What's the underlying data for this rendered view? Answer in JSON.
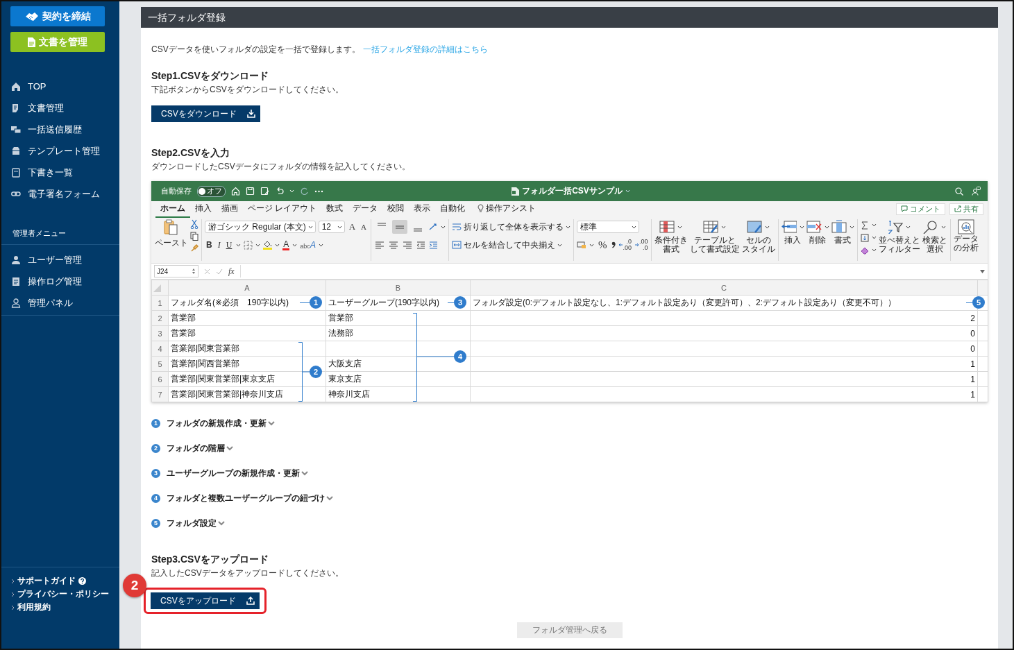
{
  "sidebar": {
    "action_buttons": [
      {
        "label": "契約を締結",
        "kind": "sign"
      },
      {
        "label": "文書を管理",
        "kind": "manage"
      }
    ],
    "nav_items": [
      {
        "label": "TOP",
        "kind": "home"
      },
      {
        "label": "文書管理",
        "kind": "document"
      },
      {
        "label": "一括送信履歴",
        "kind": "batch"
      },
      {
        "label": "テンプレート管理",
        "kind": "template"
      },
      {
        "label": "下書き一覧",
        "kind": "draft"
      },
      {
        "label": "電子署名フォーム",
        "kind": "link"
      }
    ],
    "admin_heading": "管理者メニュー",
    "admin_items": [
      {
        "label": "ユーザー管理",
        "kind": "user"
      },
      {
        "label": "操作ログ管理",
        "kind": "log"
      },
      {
        "label": "管理パネル",
        "kind": "panel"
      }
    ],
    "footer_links": [
      {
        "label": "サポートガイド",
        "help": true
      },
      {
        "label": "プライバシー・ポリシー",
        "help": false
      },
      {
        "label": "利用規約",
        "help": false
      }
    ]
  },
  "panel": {
    "title": "一括フォルダ登録",
    "intro": "CSVデータを使いフォルダの設定を一括で登録します。",
    "intro_link": "一括フォルダ登録の詳細はこちら",
    "steps": [
      {
        "heading": "Step1.CSVをダウンロード",
        "description": "下記ボタンからCSVをダウンロードしてください。",
        "button": {
          "label": "CSVをダウンロード",
          "kind": "download"
        }
      },
      {
        "heading": "Step2.CSVを入力",
        "description": "ダウンロードしたCSVデータにフォルダの情報を記入してください。",
        "spreadsheet": {
          "autosave_label": "自動保存",
          "autosave": {
            "label": "オフ",
            "on": false
          },
          "file_title": "フォルダ一括CSVサンプル",
          "ribbon_tabs": [
            {
              "label": "ホーム",
              "selected": true
            },
            {
              "label": "挿入",
              "selected": false
            },
            {
              "label": "描画",
              "selected": false
            },
            {
              "label": "ページ レイアウト",
              "selected": false
            },
            {
              "label": "数式",
              "selected": false
            },
            {
              "label": "データ",
              "selected": false
            },
            {
              "label": "校閲",
              "selected": false
            },
            {
              "label": "表示",
              "selected": false
            },
            {
              "label": "自動化",
              "selected": false
            }
          ],
          "assist": "操作アシスト",
          "comment_button": "コメント",
          "share_button": "共有",
          "paste_label": "ペースト",
          "font_name": "游ゴシック Regular (本文)",
          "font_size": "12",
          "font_size_buttons": [
            "A",
            "A"
          ],
          "style_buttons": [
            "B",
            "I",
            "U"
          ],
          "font_color": "A",
          "phonetic": [
            "abc",
            "A"
          ],
          "vertical_align": [
            {
              "selected": false
            },
            {
              "selected": true
            },
            {
              "selected": false
            }
          ],
          "wrap_text": "折り返して全体を表示する",
          "merge_center": "セルを結合して中央揃え",
          "number_format": "標準",
          "percent": "%",
          "decimal_buttons": [
            [
              ".0",
              ".00"
            ],
            [
              ".00",
              ".0"
            ]
          ],
          "cell_tools": [
            {
              "lines": [
                "条件付き",
                "書式"
              ],
              "kind": "conditional"
            },
            {
              "lines": [
                "テーブルと",
                "して書式設定"
              ],
              "kind": "table"
            },
            {
              "lines": [
                "セルの",
                "スタイル"
              ],
              "kind": "styles"
            }
          ],
          "row_tools": [
            {
              "lines": [
                "挿入"
              ],
              "kind": "insert"
            },
            {
              "lines": [
                "削除"
              ],
              "kind": "delete"
            },
            {
              "lines": [
                "書式"
              ],
              "kind": "format"
            }
          ],
          "edit_tools": [
            {
              "lines": [
                "並べ替えと",
                "フィルター"
              ],
              "kind": "sort"
            },
            {
              "lines": [
                "検索と",
                "選択"
              ],
              "kind": "find"
            }
          ],
          "analysis": [
            "データ",
            "の分析"
          ],
          "name_box": "J24",
          "formula_symbol": "fx",
          "columns": [
            "A",
            "B",
            "C"
          ],
          "header_row": {
            "number": "1",
            "cells": [
              "フォルダ名(※必須　190字以内)",
              "ユーザーグループ(190字以内)",
              "フォルダ設定(0:デフォルト設定なし、1:デフォルト設定あり（変更許可）、2:デフォルト設定あり（変更不可））"
            ]
          },
          "rows": [
            {
              "number": "2",
              "folder": "営業部",
              "group": "営業部",
              "setting": "2"
            },
            {
              "number": "3",
              "folder": "営業部",
              "group": "法務部",
              "setting": "0"
            },
            {
              "number": "4",
              "folder": "営業部|関東営業部",
              "setting": "0"
            },
            {
              "number": "5",
              "folder": "営業部|関西営業部",
              "group": "大阪支店",
              "setting": "1"
            },
            {
              "number": "6",
              "folder": "営業部|関東営業部|東京支店",
              "group": "東京支店",
              "setting": "1"
            },
            {
              "number": "7",
              "folder": "営業部|関東営業部|神奈川支店",
              "group": "神奈川支店",
              "setting": "1"
            }
          ],
          "callouts": [
            {
              "number": "1",
              "kind": "marker"
            },
            {
              "number": "3",
              "kind": "marker"
            },
            {
              "number": "5",
              "kind": "marker"
            },
            {
              "number": "2",
              "kind": "bracket"
            },
            {
              "number": "4",
              "kind": "bracket"
            }
          ]
        },
        "notes": [
          {
            "number": "1",
            "label": "フォルダの新規作成・更新",
            "expanded": false
          },
          {
            "number": "2",
            "label": "フォルダの階層",
            "expanded": false
          },
          {
            "number": "3",
            "label": "ユーザーグループの新規作成・更新",
            "expanded": false
          },
          {
            "number": "4",
            "label": "フォルダと複数ユーザーグループの紐づけ",
            "expanded": false
          },
          {
            "number": "5",
            "label": "フォルダ設定",
            "expanded": false
          }
        ]
      },
      {
        "heading": "Step3.CSVをアップロード",
        "description": "記入したCSVデータをアップロードしてください。",
        "button": {
          "label": "CSVをアップロード",
          "kind": "upload"
        },
        "highlight": "2"
      }
    ],
    "back_button": "フォルダ管理へ戻る"
  }
}
